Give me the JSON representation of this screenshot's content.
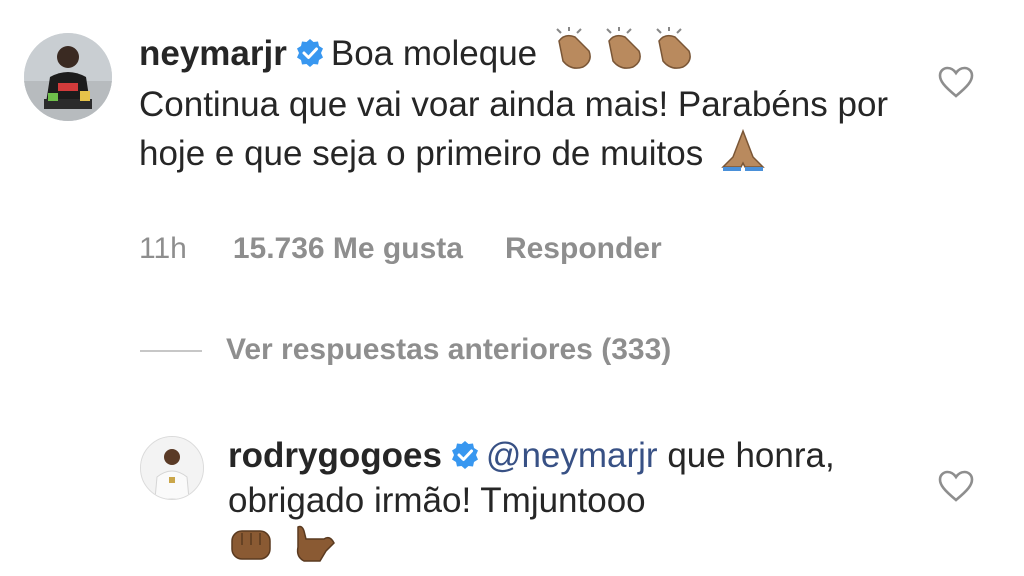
{
  "comments": [
    {
      "username": "neymarjr",
      "verified": true,
      "text_line1": "Boa moleque",
      "text_rest": "Continua que vai voar ainda mais! Parabéns por hoje e que seja o primeiro de muitos",
      "emoji_1": "clapping-hands",
      "emoji_2": "folded-hands",
      "meta": {
        "time": "11h",
        "likes": "15.736 Me gusta",
        "reply": "Responder"
      }
    },
    {
      "username": "rodrygogoes",
      "verified": true,
      "mention": "@neymarjr",
      "text": "que honra, obrigado irmão! Tmjuntooo",
      "emojis": [
        "oncoming-fist",
        "call-me-hand"
      ]
    }
  ],
  "view_replies": "Ver respuestas anteriores (333)",
  "colors": {
    "verified_badge": "#3897f0",
    "mention": "#385185",
    "secondary_text": "#8e8e8e",
    "emoji_skin": "#a0703f"
  }
}
